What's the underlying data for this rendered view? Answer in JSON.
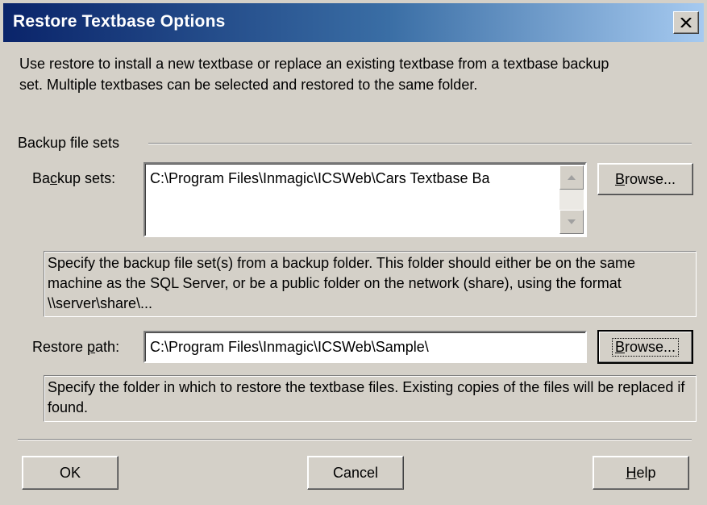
{
  "window": {
    "title": "Restore Textbase Options",
    "close_icon": "close-icon"
  },
  "intro": {
    "text": "Use restore to install a new textbase or replace an existing textbase from a textbase backup set. Multiple textbases can be selected and restored to the same folder."
  },
  "backup_group": {
    "label": "Backup file sets"
  },
  "backup_sets": {
    "label_prefix": "Ba",
    "label_access_key": "c",
    "label_suffix": "kup sets:",
    "value": "C:\\Program Files\\Inmagic\\ICSWeb\\Cars Textbase Ba",
    "browse_access_key": "B",
    "browse_rest": "rowse...",
    "hint": "Specify the backup file set(s) from a backup folder. This folder should either be on the same machine as the SQL Server, or be a public folder on the network (share), using the format \\\\server\\share\\..."
  },
  "restore_path": {
    "label_prefix": "Restore ",
    "label_access_key": "p",
    "label_suffix": "ath:",
    "value": "C:\\Program Files\\Inmagic\\ICSWeb\\Sample\\",
    "browse_access_key": "B",
    "browse_rest": "rowse...",
    "hint": "Specify the folder in which to restore the textbase files. Existing copies of the files will be replaced if found."
  },
  "buttons": {
    "ok": "OK",
    "cancel": "Cancel",
    "help_access_key": "H",
    "help_rest": "elp"
  }
}
